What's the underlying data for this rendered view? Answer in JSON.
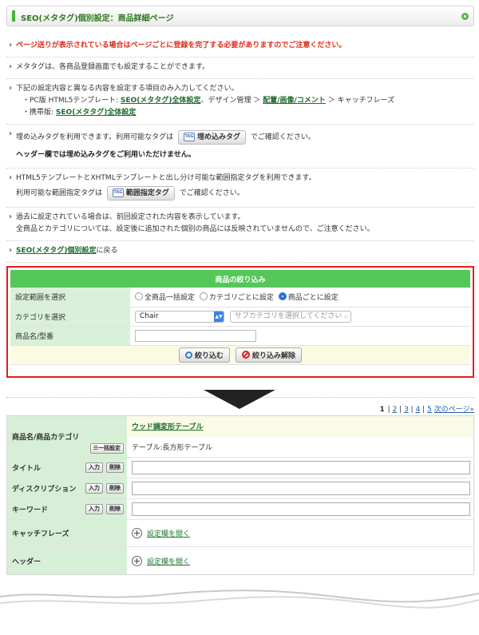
{
  "header": {
    "title": "SEO(メタタグ)個別設定：商品詳細ページ"
  },
  "notes": {
    "warning": "ページ送りが表示されている場合はページごとに登録を完了する必要がありますのでご注意ください。",
    "n2": "メタタグは、各商品登録画面でも設定することができます。",
    "n3_line1": "下記の設定内容と異なる内容を設定する項目のみ入力してください。",
    "n3_pc_prefix": "・PC版 HTML5テンプレート:",
    "n3_pc_link1": "SEO(メタタグ)全体設定",
    "n3_pc_mid": "、デザイン管理 ＞",
    "n3_pc_link2": "配置/画像/コメント",
    "n3_pc_suffix": "＞ キャッチフレーズ",
    "n3_mobile_prefix": "・携帯版:",
    "n3_mobile_link": "SEO(メタタグ)全体設定",
    "n4_prefix": "埋め込みタグを利用できます。利用可能なタグは",
    "n4_button": "埋め込みタグ",
    "n4_suffix": "でご確認ください。",
    "n4_bold": "ヘッダー欄では埋め込みタグをご利用いただけません。",
    "n5_line1": "HTML5テンプレートとXHTMLテンプレートと出し分け可能な範囲指定タグを利用できます。",
    "n5_prefix": "利用可能な範囲指定タグは",
    "n5_button": "範囲指定タグ",
    "n5_suffix": "でご確認ください。",
    "n6_line1": "過去に設定されている場合は、前回設定された内容を表示しています。",
    "n6_line2": "全商品とカテゴリについては、設定後に追加された個別の商品には反映されていませんので、ご注意ください。",
    "back_link": "SEO(メタタグ)個別設定",
    "back_suffix": "に戻る",
    "tag_icon_text": "TAG"
  },
  "filter": {
    "caption": "商品の絞り込み",
    "scope_label": "設定範囲を選択",
    "scope_options": [
      "全商品一括設定",
      "カテゴリごとに設定",
      "商品ごとに設定"
    ],
    "scope_selected": "商品ごとに設定",
    "category_label": "カテゴリを選択",
    "category_value": "Chair",
    "subcategory_placeholder": "サブカテゴリを選択してください",
    "name_label": "商品名/型番",
    "name_value": "",
    "search_button": "絞り込む",
    "clear_button": "絞り込み解除"
  },
  "pager": {
    "current": "1",
    "pages": [
      "2",
      "3",
      "4",
      "5"
    ],
    "next": "次のページ»"
  },
  "product": {
    "name_header": "商品名/商品カテゴリ",
    "bulk_button": "一括設定",
    "product_link": "ウッド調変形テーブル",
    "category_text": "テーブル:長方形テーブル",
    "input_button": "入力",
    "delete_button": "削除",
    "rows": {
      "title": "タイトル",
      "description": "ディスクリプション",
      "keyword": "キーワード",
      "catchphrase": "キャッチフレーズ",
      "header": "ヘッダー"
    },
    "open_settings": "設定欄を開く"
  },
  "colors": {
    "accent_green": "#55c75a",
    "warning_red": "#e02a1a",
    "highlight_border": "#e41e1e"
  }
}
